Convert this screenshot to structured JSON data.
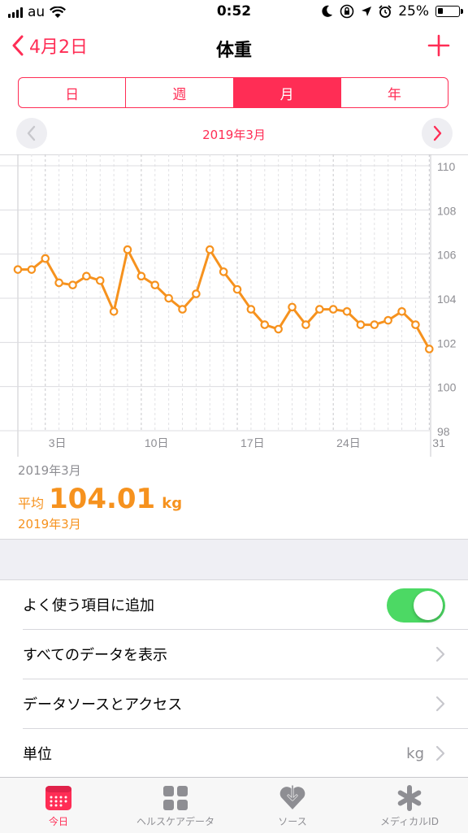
{
  "status_bar": {
    "carrier": "au",
    "time": "0:52",
    "battery": "25%",
    "battery_level": 0.25
  },
  "nav": {
    "back_label": "4月2日",
    "title": "体重"
  },
  "segments": [
    {
      "label": "日",
      "active": false
    },
    {
      "label": "週",
      "active": false
    },
    {
      "label": "月",
      "active": true
    },
    {
      "label": "年",
      "active": false
    }
  ],
  "period": {
    "label": "2019年3月"
  },
  "chart_data": {
    "type": "line",
    "x_ticks": [
      "3日",
      "10日",
      "17日",
      "24日",
      "31"
    ],
    "x_tick_days": [
      3,
      10,
      17,
      24,
      31
    ],
    "y_ticks": [
      "98",
      "100",
      "102",
      "104",
      "106",
      "108",
      "110"
    ],
    "ylim": [
      98,
      110
    ],
    "xlim": [
      1,
      31
    ],
    "line_color": "#f6921e",
    "x": [
      1,
      2,
      3,
      4,
      5,
      6,
      7,
      8,
      9,
      10,
      11,
      12,
      13,
      14,
      15,
      16,
      17,
      18,
      19,
      20,
      21,
      22,
      23,
      24,
      25,
      26,
      27,
      28,
      29,
      30,
      31
    ],
    "values": [
      105.3,
      105.3,
      105.8,
      104.7,
      104.6,
      105.0,
      104.8,
      103.4,
      106.2,
      105.0,
      104.6,
      104.0,
      103.5,
      104.2,
      106.2,
      105.2,
      104.4,
      103.5,
      102.8,
      102.6,
      103.6,
      102.8,
      103.5,
      103.5,
      103.4,
      102.8,
      102.8,
      103.0,
      103.4,
      102.8,
      101.7
    ],
    "grid": true
  },
  "chart_caption": "2019年3月",
  "average": {
    "prefix": "平均",
    "value": "104.01",
    "unit": "kg",
    "period": "2019年3月"
  },
  "rows": {
    "favorites": "よく使う項目に追加",
    "show_all": "すべてのデータを表示",
    "sources": "データソースとアクセス",
    "unit_label": "単位",
    "unit_value": "kg"
  },
  "favorites_on": true,
  "accent_color": "#ff2d55",
  "tabs": [
    {
      "label": "今日",
      "icon": "calendar-icon",
      "active": true
    },
    {
      "label": "ヘルスケアデータ",
      "icon": "grid-icon",
      "active": false
    },
    {
      "label": "ソース",
      "icon": "heart-download-icon",
      "active": false
    },
    {
      "label": "メディカルID",
      "icon": "asterisk-icon",
      "active": false
    }
  ]
}
